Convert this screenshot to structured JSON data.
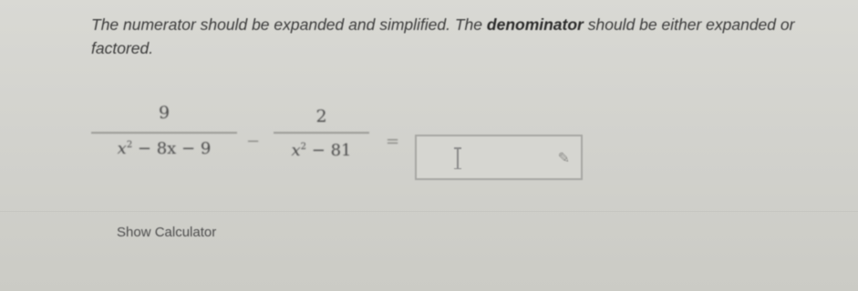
{
  "instructions": {
    "text_1": "The numerator should be expanded and simplified. The ",
    "bold_1": "denominator",
    "text_2": " should be either expanded or factored."
  },
  "expression": {
    "fraction_1": {
      "numerator": "9",
      "denominator_var": "x",
      "denominator_exp": "2",
      "denominator_rest": " − 8x − 9"
    },
    "operator": "−",
    "fraction_2": {
      "numerator": "2",
      "denominator_var": "x",
      "denominator_exp": "2",
      "denominator_rest": " − 81"
    },
    "equals": "="
  },
  "answer": {
    "value": "",
    "icons": [
      "text-cursor-icon",
      "pencil-icon"
    ]
  },
  "calculator": {
    "label": "Show Calculator"
  }
}
